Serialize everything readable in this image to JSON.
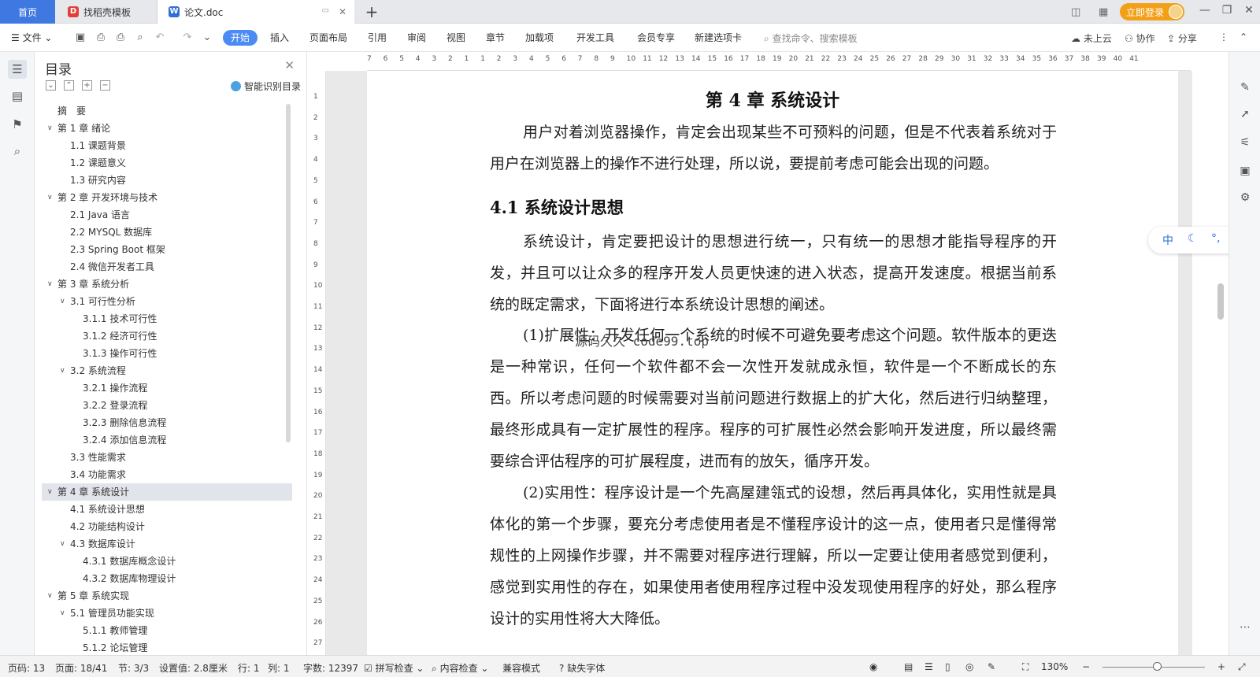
{
  "tabs": {
    "home": "首页",
    "template": "找稻壳模板",
    "doc": "论文.doc"
  },
  "topbar": {
    "login": "立即登录"
  },
  "menu": {
    "file": "文件",
    "items": [
      "开始",
      "插入",
      "页面布局",
      "引用",
      "审阅",
      "视图",
      "章节",
      "加载项",
      "开发工具",
      "会员专享",
      "新建选项卡"
    ],
    "search_placeholder": "查找命令、搜索模板",
    "cloud": "未上云",
    "collab": "协作",
    "share": "分享"
  },
  "toc": {
    "title": "目录",
    "smart_label": "智能识别目录",
    "items": [
      {
        "text": "摘　要",
        "level": 1,
        "chev": ""
      },
      {
        "text": "第 1 章  绪论",
        "level": 1,
        "chev": "v"
      },
      {
        "text": "1.1  课题背景",
        "level": 2,
        "chev": ""
      },
      {
        "text": "1.2  课题意义",
        "level": 2,
        "chev": ""
      },
      {
        "text": "1.3  研究内容",
        "level": 2,
        "chev": ""
      },
      {
        "text": "第 2 章  开发环境与技术",
        "level": 1,
        "chev": "v"
      },
      {
        "text": "2.1 Java 语言",
        "level": 2,
        "chev": ""
      },
      {
        "text": "2.2 MYSQL 数据库",
        "level": 2,
        "chev": ""
      },
      {
        "text": "2.3 Spring Boot 框架",
        "level": 2,
        "chev": ""
      },
      {
        "text": "2.4 微信开发者工具",
        "level": 2,
        "chev": ""
      },
      {
        "text": "第 3 章  系统分析",
        "level": 1,
        "chev": "v"
      },
      {
        "text": "3.1  可行性分析",
        "level": 2,
        "chev": "v"
      },
      {
        "text": "3.1.1  技术可行性",
        "level": 3,
        "chev": ""
      },
      {
        "text": "3.1.2  经济可行性",
        "level": 3,
        "chev": ""
      },
      {
        "text": "3.1.3  操作可行性",
        "level": 3,
        "chev": ""
      },
      {
        "text": "3.2  系统流程",
        "level": 2,
        "chev": "v"
      },
      {
        "text": "3.2.1  操作流程",
        "level": 3,
        "chev": ""
      },
      {
        "text": "3.2.2  登录流程",
        "level": 3,
        "chev": ""
      },
      {
        "text": "3.2.3  删除信息流程",
        "level": 3,
        "chev": ""
      },
      {
        "text": "3.2.4  添加信息流程",
        "level": 3,
        "chev": ""
      },
      {
        "text": "3.3  性能需求",
        "level": 2,
        "chev": ""
      },
      {
        "text": "3.4  功能需求",
        "level": 2,
        "chev": ""
      },
      {
        "text": "第 4 章  系统设计",
        "level": 1,
        "chev": "v",
        "selected": true
      },
      {
        "text": "4.1  系统设计思想",
        "level": 2,
        "chev": ""
      },
      {
        "text": "4.2  功能结构设计",
        "level": 2,
        "chev": ""
      },
      {
        "text": "4.3  数据库设计",
        "level": 2,
        "chev": "v"
      },
      {
        "text": "4.3.1  数据库概念设计",
        "level": 3,
        "chev": ""
      },
      {
        "text": "4.3.2  数据库物理设计",
        "level": 3,
        "chev": ""
      },
      {
        "text": "第 5 章  系统实现",
        "level": 1,
        "chev": "v"
      },
      {
        "text": "5.1  管理员功能实现",
        "level": 2,
        "chev": "v"
      },
      {
        "text": "5.1.1  教师管理",
        "level": 3,
        "chev": ""
      },
      {
        "text": "5.1.2  论坛管理",
        "level": 3,
        "chev": ""
      }
    ]
  },
  "ruler": {
    "top_numbers": [
      "7",
      "6",
      "5",
      "4",
      "3",
      "2",
      "1",
      "1",
      "2",
      "3",
      "4",
      "5",
      "6",
      "7",
      "8",
      "9",
      "10",
      "11",
      "12",
      "13",
      "14",
      "15",
      "16",
      "17",
      "18",
      "19",
      "20",
      "21",
      "22",
      "23",
      "24",
      "25",
      "26",
      "27",
      "28",
      "29",
      "30",
      "31",
      "32",
      "33",
      "34",
      "35",
      "36",
      "37",
      "38",
      "39",
      "40",
      "41"
    ],
    "left_numbers": [
      "1",
      "2",
      "3",
      "4",
      "5",
      "6",
      "7",
      "8",
      "9",
      "10",
      "11",
      "12",
      "13",
      "14",
      "15",
      "16",
      "17",
      "18",
      "19",
      "20",
      "21",
      "22",
      "23",
      "24",
      "25",
      "26",
      "27"
    ]
  },
  "document": {
    "chapter_title": "第 4 章  系统设计",
    "intro": "用户对着浏览器操作，肯定会出现某些不可预料的问题，但是不代表着系统对于用户在浏览器上的操作不进行处理，所以说，要提前考虑可能会出现的问题。",
    "section_title": "4.1  系统设计思想",
    "p1": "系统设计，肯定要把设计的思想进行统一，只有统一的思想才能指导程序的开发，并且可以让众多的程序开发人员更快速的进入状态，提高开发速度。根据当前系统的既定需求，下面将进行本系统设计思想的阐述。",
    "p2": "(1)扩展性：开发任何一个系统的时候不可避免要考虑这个问题。软件版本的更迭是一种常识，任何一个软件都不会一次性开发就成永恒，软件是一个不断成长的东西。所以考虑问题的时候需要对当前问题进行数据上的扩大化，然后进行归纳整理，最终形成具有一定扩展性的程序。程序的可扩展性必然会影响开发进度，所以最终需要综合评估程序的可扩展程度，进而有的放矢，循序开发。",
    "p3": "(2)实用性：程序设计是一个先高屋建瓴式的设想，然后再具体化，实用性就是具体化的第一个步骤，要充分考虑使用者是不懂程序设计的这一点，使用者只是懂得常规性的上网操作步骤，并不需要对程序进行理解，所以一定要让使用者感觉到便利，感觉到实用性的存在，如果使用者使用程序过程中没发现使用程序的好处，那么程序设计的实用性将大大降低。",
    "watermark": "源码久久 code99.top"
  },
  "floatbar": {
    "lang": "中"
  },
  "status": {
    "page_code": "页码: 13",
    "page": "页面: 18/41",
    "section": "节: 3/3",
    "setting": "设置值: 2.8厘米",
    "row": "行: 1",
    "col": "列: 1",
    "words": "字数: 12397",
    "spell": "拼写检查",
    "content_check": "内容检查",
    "compat": "兼容模式",
    "missing_font": "缺失字体",
    "zoom": "130%"
  }
}
